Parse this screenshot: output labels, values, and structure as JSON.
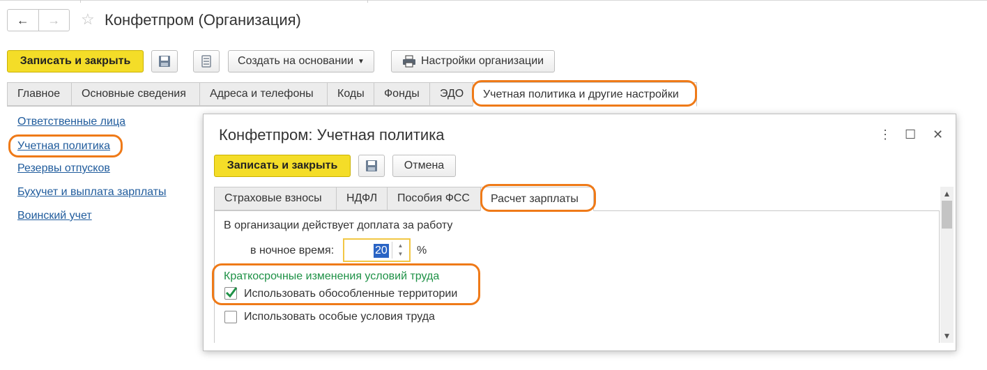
{
  "window": {
    "title": "Конфетпром (Организация)",
    "back_icon": "←",
    "forward_icon": "→",
    "favorite_icon": "☆"
  },
  "toolbar": {
    "save_close_label": "Записать и закрыть",
    "create_based_label": "Создать на основании",
    "org_settings_label": "Настройки организации"
  },
  "tabs": [
    {
      "label": "Главное"
    },
    {
      "label": "Основные сведения"
    },
    {
      "label": "Адреса и телефоны"
    },
    {
      "label": "Коды"
    },
    {
      "label": "Фонды"
    },
    {
      "label": "ЭДО"
    },
    {
      "label": "Учетная политика и другие настройки",
      "active": true
    }
  ],
  "sidebar": {
    "items": [
      {
        "label": "Ответственные лица"
      },
      {
        "label": "Учетная политика"
      },
      {
        "label": "Резервы отпусков"
      },
      {
        "label": "Бухучет и выплата зарплаты"
      },
      {
        "label": "Воинский учет"
      }
    ]
  },
  "dialog": {
    "title": "Конфетпром: Учетная политика",
    "more_icon": "⋮",
    "maximize_icon": "☐",
    "close_icon": "✕",
    "save_close_label": "Записать и закрыть",
    "cancel_label": "Отмена",
    "tabs": [
      {
        "label": "Страховые взносы"
      },
      {
        "label": "НДФЛ"
      },
      {
        "label": "Пособия ФСС"
      },
      {
        "label": "Расчет зарплаты",
        "active": true
      }
    ],
    "surcharge_text": "В организации действует доплата за работу",
    "night_label": "в ночное время:",
    "night_value": "20",
    "percent_sign": "%",
    "section_title": "Краткосрочные изменения условий труда",
    "checkbox_territories": {
      "label": "Использовать обособленные территории",
      "checked": true
    },
    "checkbox_special": {
      "label": "Использовать особые условия труда",
      "checked": false
    }
  },
  "colors": {
    "accent_yellow": "#f4dd28",
    "highlight_orange": "#ef7a18",
    "link_blue": "#1f5b9c",
    "section_green": "#1e9146",
    "check_green": "#1e9146",
    "selection_blue": "#2a64c5"
  }
}
